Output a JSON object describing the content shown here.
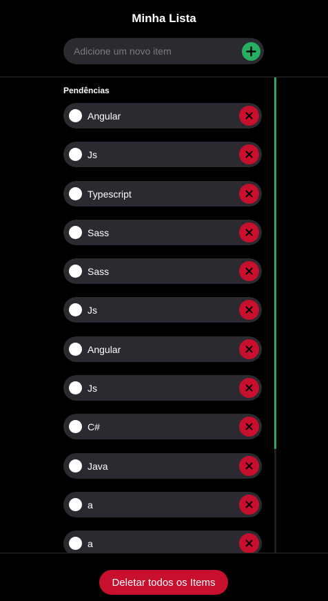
{
  "app": {
    "title": "Minha Lista"
  },
  "new_item": {
    "placeholder": "Adicione um novo item"
  },
  "pending": {
    "title": "Pendências",
    "items": [
      {
        "label": "Angular"
      },
      {
        "label": "Js"
      },
      {
        "label": "Typescript"
      },
      {
        "label": "Sass"
      },
      {
        "label": "Sass"
      },
      {
        "label": "Js"
      },
      {
        "label": "Angular"
      },
      {
        "label": "Js"
      },
      {
        "label": "C#"
      },
      {
        "label": "Java"
      },
      {
        "label": "a"
      },
      {
        "label": "a"
      }
    ]
  },
  "footer": {
    "delete_all_label": "Deletar todos os Items"
  },
  "colors": {
    "accent_green": "#27ae60",
    "danger_red": "#c8102e",
    "surface": "#2a2a30",
    "background": "#000000"
  },
  "icons": {
    "add": "plus-icon",
    "delete": "close-icon",
    "toggle": "circle-checkbox-icon"
  }
}
